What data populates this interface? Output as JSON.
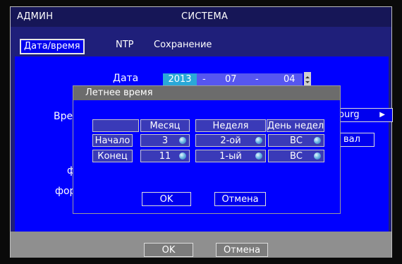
{
  "window": {
    "title_left": "АДМИН",
    "title_center": "СИСТЕМА"
  },
  "tabs": [
    {
      "label": "Дата/время"
    },
    {
      "label": "NTP"
    },
    {
      "label": "Сохранение"
    }
  ],
  "main": {
    "date_label": "Дата",
    "date_year": "2013",
    "date_month": "07",
    "date_day": "04",
    "date_sep": "-",
    "partial_left_1": "Вре",
    "partial_left_2": "ф",
    "partial_left_3": "фор",
    "timezone_partial": "sburg",
    "interval_partial": "вал"
  },
  "dialog": {
    "title": "Летнее время",
    "headers": [
      "Месяц",
      "Неделя",
      "День недели"
    ],
    "rows": [
      {
        "label": "Начало",
        "month": "3",
        "week": "2-ой",
        "day": "ВС"
      },
      {
        "label": "Конец",
        "month": "11",
        "week": "1-ый",
        "day": "ВС"
      }
    ],
    "ok_label": "OK",
    "cancel_label": "Отмена"
  },
  "bottom": {
    "ok_label": "OK",
    "cancel_label": "Отмена"
  }
}
